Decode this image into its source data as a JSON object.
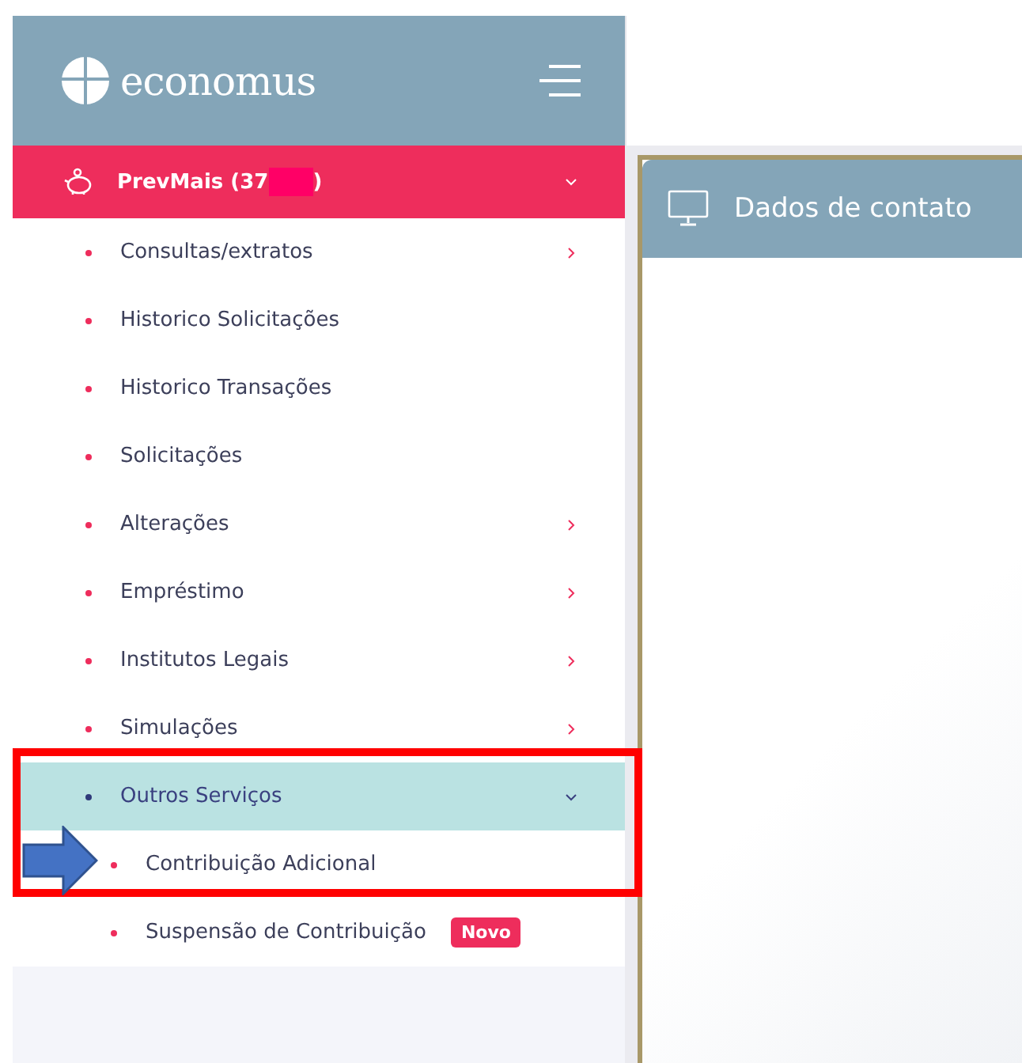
{
  "sidebar": {
    "brand": "economus",
    "account": {
      "label": "PrevMais (37",
      "label_end": ")",
      "expanded": true
    },
    "items": [
      {
        "label": "Consultas/extratos",
        "has_submenu": true,
        "expanded": false,
        "selected": false
      },
      {
        "label": "Historico Solicitações",
        "has_submenu": false,
        "selected": false
      },
      {
        "label": "Historico Transações",
        "has_submenu": false,
        "selected": false
      },
      {
        "label": "Solicitações",
        "has_submenu": false,
        "selected": false
      },
      {
        "label": "Alterações",
        "has_submenu": true,
        "expanded": false,
        "selected": false
      },
      {
        "label": "Empréstimo",
        "has_submenu": true,
        "expanded": false,
        "selected": false
      },
      {
        "label": "Institutos Legais",
        "has_submenu": true,
        "expanded": false,
        "selected": false
      },
      {
        "label": "Simulações",
        "has_submenu": true,
        "expanded": false,
        "selected": false
      },
      {
        "label": "Outros Serviços",
        "has_submenu": true,
        "expanded": true,
        "selected": true,
        "children": [
          {
            "label": "Contribuição Adicional"
          },
          {
            "label": "Suspensão de Contribuição",
            "badge": "Novo"
          }
        ]
      }
    ]
  },
  "card": {
    "title": "Dados de contato"
  }
}
